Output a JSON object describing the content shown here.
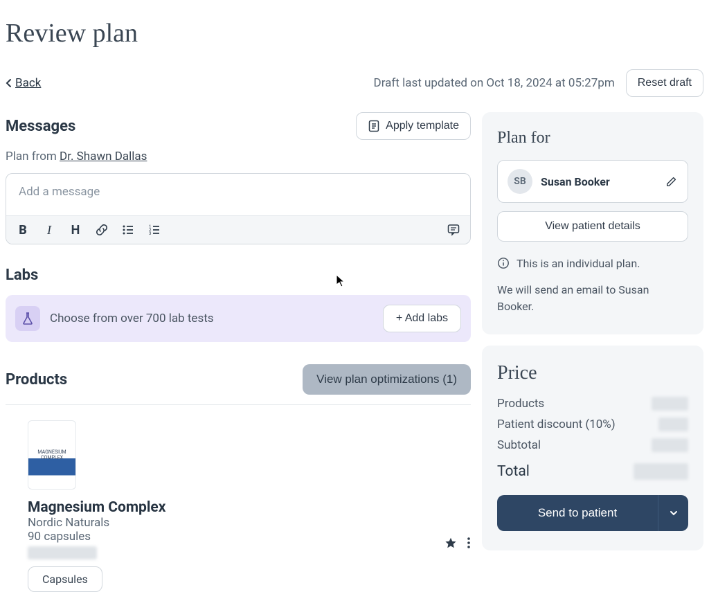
{
  "page_title": "Review plan",
  "back_label": "Back",
  "draft_timestamp": "Draft last updated on Oct 18, 2024 at 05:27pm",
  "reset_draft_label": "Reset draft",
  "messages": {
    "heading": "Messages",
    "apply_template_label": "Apply template",
    "plan_from_prefix": "Plan from ",
    "provider_name": "Dr. Shawn Dallas",
    "placeholder": "Add a message"
  },
  "labs": {
    "heading": "Labs",
    "banner_text": "Choose from over 700 lab tests",
    "add_labs_label": "+ Add labs"
  },
  "products": {
    "heading": "Products",
    "optimizations_label": "View plan optimizations (1)",
    "items": [
      {
        "name": "Magnesium Complex",
        "brand": "Nordic Naturals",
        "quantity": "90 capsules",
        "form": "Capsules",
        "img_label": "MAGNESIUM COMPLEX"
      }
    ]
  },
  "plan_for": {
    "heading": "Plan for",
    "patient_initials": "SB",
    "patient_name": "Susan Booker",
    "view_details_label": "View patient details",
    "individual_note": "This is an individual plan.",
    "email_note": "We will send an email to Susan Booker."
  },
  "price": {
    "heading": "Price",
    "rows": [
      {
        "label": "Products"
      },
      {
        "label": "Patient discount (10%)"
      },
      {
        "label": "Subtotal"
      }
    ],
    "total_label": "Total",
    "send_label": "Send to patient"
  }
}
